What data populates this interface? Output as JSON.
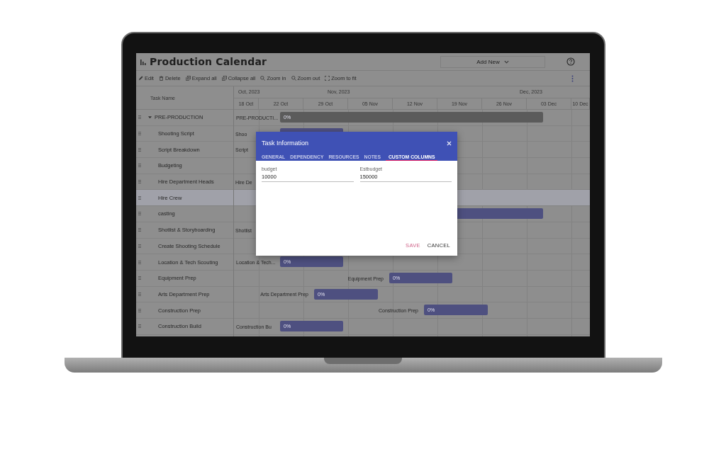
{
  "app": {
    "title": "Production Calendar",
    "add_new": "Add New"
  },
  "toolbar": [
    {
      "kind": "edit",
      "label": "Edit"
    },
    {
      "kind": "delete",
      "label": "Delete"
    },
    {
      "kind": "expand",
      "label": "Expand all"
    },
    {
      "kind": "collapse",
      "label": "Collapse all"
    },
    {
      "kind": "zoom-in",
      "label": "Zoom in"
    },
    {
      "kind": "zoom-out",
      "label": "Zoom out"
    },
    {
      "kind": "fit",
      "label": "Zoom to fit"
    }
  ],
  "grid": {
    "column": "Task Name",
    "tasks": [
      {
        "name": "PRE-PRODUCTION",
        "expanded": true,
        "selected": false,
        "timeline_label": "PRE-PRODUCTI...",
        "progress": "0%",
        "children": [
          {
            "name": "Shooting Script",
            "selected": false,
            "timeline_label": "Shoo"
          },
          {
            "name": "Script Breakdown",
            "selected": false,
            "timeline_label": "Script"
          },
          {
            "name": "Budgeting",
            "selected": false
          },
          {
            "name": "Hire Department Heads",
            "selected": false,
            "timeline_label": "Hire De"
          },
          {
            "name": "Hire Crew",
            "selected": true
          },
          {
            "name": "casting",
            "selected": false
          },
          {
            "name": "Shotlist & Storyboarding",
            "selected": false,
            "timeline_label": "Shotlist"
          },
          {
            "name": "Create Shooting Schedule",
            "selected": false
          },
          {
            "name": "Location & Tech Scouting",
            "selected": false,
            "timeline_label": "Location & Tech...",
            "progress": "0%"
          },
          {
            "name": "Equipment Prep",
            "selected": false,
            "timeline_label": "Equipment Prep",
            "progress": "0%"
          },
          {
            "name": "Arts Department Prep",
            "selected": false,
            "timeline_label": "Arts Department Prep",
            "progress": "0%"
          },
          {
            "name": "Construction Prep",
            "selected": false,
            "timeline_label": "Construction Prep",
            "progress": "0%"
          },
          {
            "name": "Construction Build",
            "selected": false,
            "timeline_label": "Construction Bu",
            "progress": "0%"
          }
        ]
      }
    ]
  },
  "timeline": {
    "months": [
      "Oct, 2023",
      "Nov, 2023",
      "Dec, 2023"
    ],
    "weeks": [
      "18 Oct",
      "22 Oct",
      "29 Oct",
      "05 Nov",
      "12 Nov",
      "19 Nov",
      "26 Nov",
      "03 Dec",
      "10 Dec"
    ]
  },
  "dialog": {
    "title": "Task Information",
    "tabs": [
      {
        "label": "GENERAL",
        "selected": false
      },
      {
        "label": "DEPENDENCY",
        "selected": false
      },
      {
        "label": "RESOURCES",
        "selected": false
      },
      {
        "label": "NOTES",
        "selected": false
      },
      {
        "label": "CUSTOM COLUMNS",
        "selected": true
      }
    ],
    "fields": [
      {
        "label": "budget",
        "value": "10000"
      },
      {
        "label": "Estbudget",
        "value": "150000"
      }
    ],
    "buttons": [
      {
        "kind": "save",
        "label": "SAVE"
      },
      {
        "kind": "cancel",
        "label": "CANCEL"
      }
    ]
  }
}
